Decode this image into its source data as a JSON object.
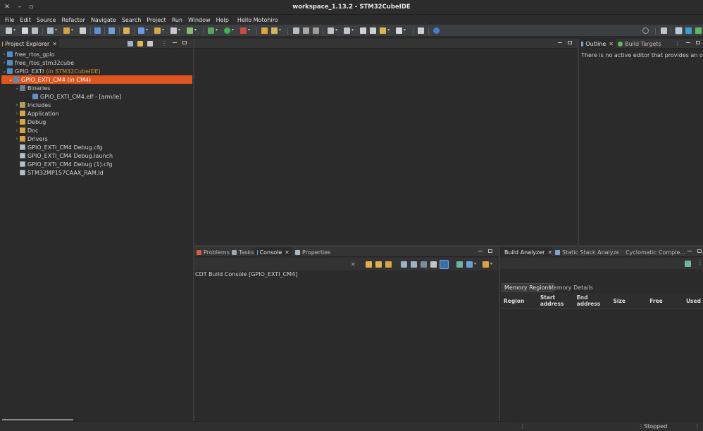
{
  "window": {
    "title": "workspace_1.13.2 - STM32CubeIDE",
    "close_glyph": "✕",
    "minimize_glyph": "–",
    "maximize_glyph": "▫"
  },
  "menu": [
    "File",
    "Edit",
    "Source",
    "Refactor",
    "Navigate",
    "Search",
    "Project",
    "Run",
    "Window",
    "Help",
    "Hello Motohiro"
  ],
  "project_explorer": {
    "tab_label": "Project Explorer",
    "tree": [
      {
        "label": "free_rtos_gpio",
        "suffix": "",
        "icon": "project-icon",
        "chevron": "›"
      },
      {
        "label": "free_rtos_stm32cube",
        "suffix": "",
        "icon": "project-icon",
        "chevron": "›"
      },
      {
        "label": "GPIO_EXTI",
        "suffix": "(in STM32CubeIDE)",
        "icon": "project-icon",
        "chevron": "⌄"
      },
      {
        "label": "GPIO_EXTI_CM4 (in CM4)",
        "suffix": "",
        "icon": "project-icon",
        "chevron": "⌄"
      },
      {
        "label": "Binaries",
        "suffix": "",
        "icon": "binaries-icon",
        "chevron": "⌄"
      },
      {
        "label": "GPIO_EXTI_CM4.elf - [arm/le]",
        "suffix": "",
        "icon": "elf-icon",
        "chevron": ""
      },
      {
        "label": "Includes",
        "suffix": "",
        "icon": "includes-icon",
        "chevron": "›"
      },
      {
        "label": "Application",
        "suffix": "",
        "icon": "folder-icon",
        "chevron": "›"
      },
      {
        "label": "Debug",
        "suffix": "",
        "icon": "folder-icon",
        "chevron": "›"
      },
      {
        "label": "Doc",
        "suffix": "",
        "icon": "folder-icon",
        "chevron": "›"
      },
      {
        "label": "Drivers",
        "suffix": "",
        "icon": "folder-icon",
        "chevron": "›"
      },
      {
        "label": "GPIO_EXTI_CM4 Debug.cfg",
        "suffix": "",
        "icon": "file-icon",
        "chevron": ""
      },
      {
        "label": "GPIO_EXTI_CM4 Debug.launch",
        "suffix": "",
        "icon": "file-icon",
        "chevron": ""
      },
      {
        "label": "GPIO_EXTI_CM4 Debug (1).cfg",
        "suffix": "",
        "icon": "file-icon",
        "chevron": ""
      },
      {
        "label": "STM32MP157CAAX_RAM.ld",
        "suffix": "",
        "icon": "file-icon",
        "chevron": ""
      }
    ]
  },
  "outline": {
    "tabs": [
      "Outline",
      "Build Targets"
    ],
    "message": "There is no active editor that provides an outline."
  },
  "bottom_left": {
    "tabs": [
      "Problems",
      "Tasks",
      "Console",
      "Properties"
    ],
    "console_text": "CDT Build Console [GPIO_EXTI_CM4]"
  },
  "bottom_right": {
    "tabs": [
      "Build Analyzer",
      "Static Stack Analyzer",
      "Cyclomatic Comple..."
    ],
    "subtabs": [
      "Memory Regions",
      "Memory Details"
    ],
    "columns": [
      "Region",
      "Start address",
      "End address",
      "Size",
      "Free",
      "Used"
    ]
  },
  "status": {
    "text": "Stopped"
  },
  "colors": {
    "selection": "#e0541e",
    "background": "#2b2b2b"
  }
}
